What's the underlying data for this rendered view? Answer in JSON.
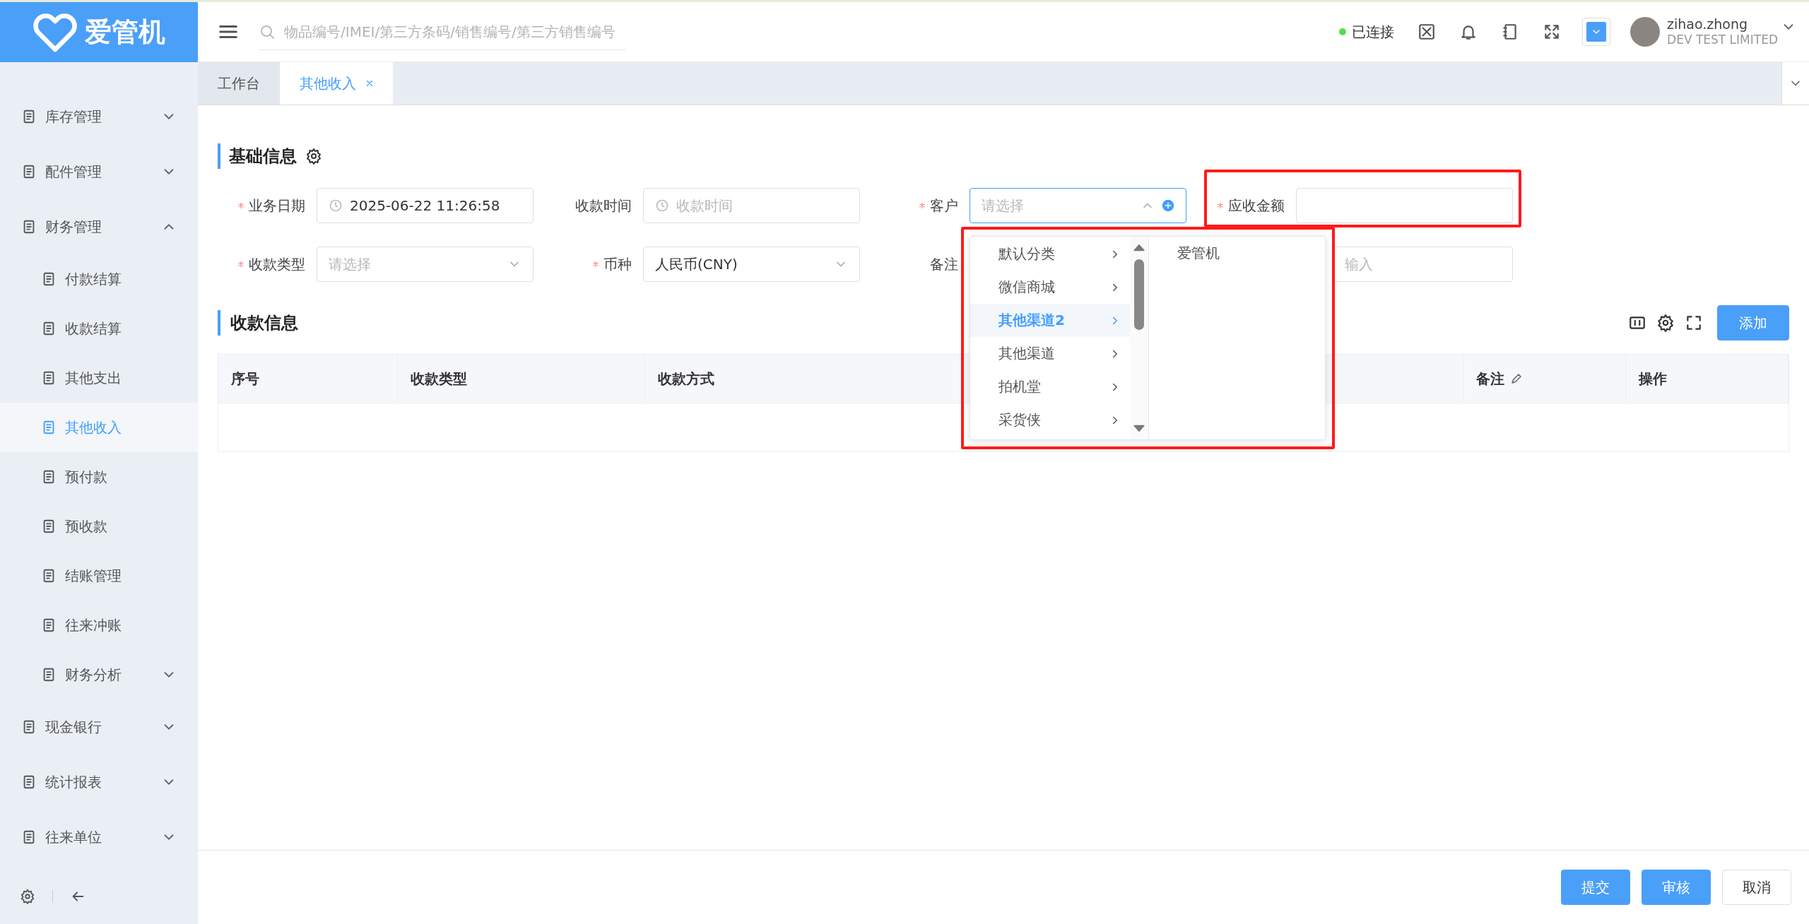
{
  "app": {
    "logo_text": "爱管机"
  },
  "header": {
    "search": {
      "placeholder": "物品编号/IMEI/第三方条码/销售编号/第三方销售编号"
    },
    "status": {
      "label": "已连接",
      "connected": true
    },
    "user": {
      "name": "zihao.zhong",
      "company": "DEV TEST LIMITED"
    }
  },
  "sidebar": {
    "items": [
      {
        "label": "库存管理",
        "kind": "group",
        "expanded": false
      },
      {
        "label": "配件管理",
        "kind": "group",
        "expanded": false
      },
      {
        "label": "财务管理",
        "kind": "group",
        "expanded": true,
        "children": [
          {
            "label": "付款结算",
            "kind": "link",
            "selected": false
          },
          {
            "label": "收款结算",
            "kind": "link",
            "selected": false
          },
          {
            "label": "其他支出",
            "kind": "link",
            "selected": false
          },
          {
            "label": "其他收入",
            "kind": "link",
            "selected": true
          },
          {
            "label": "预付款",
            "kind": "link",
            "selected": false
          },
          {
            "label": "预收款",
            "kind": "link",
            "selected": false
          },
          {
            "label": "结账管理",
            "kind": "link",
            "selected": false
          },
          {
            "label": "往来冲账",
            "kind": "link",
            "selected": false
          },
          {
            "label": "财务分析",
            "kind": "group",
            "expanded": false
          }
        ]
      },
      {
        "label": "现金银行",
        "kind": "group",
        "expanded": false
      },
      {
        "label": "统计报表",
        "kind": "group",
        "expanded": false
      },
      {
        "label": "往来单位",
        "kind": "group",
        "expanded": false
      }
    ]
  },
  "tabs": [
    {
      "label": "工作台",
      "selected": false,
      "closable": false
    },
    {
      "label": "其他收入",
      "selected": true,
      "closable": true
    }
  ],
  "basic_info": {
    "title": "基础信息",
    "fields": [
      {
        "label": "业务日期",
        "required": true,
        "kind": "date",
        "value": "2025-06-22 11:26:58",
        "focused": false
      },
      {
        "label": "收款时间",
        "required": false,
        "kind": "date",
        "placeholder": "收款时间",
        "focused": false
      },
      {
        "label": "客户",
        "required": true,
        "kind": "cascader",
        "placeholder": "请选择",
        "focused": true
      },
      {
        "label": "应收金额",
        "required": true,
        "kind": "text",
        "focused": false
      },
      {
        "label": "收款类型",
        "required": true,
        "kind": "select",
        "placeholder": "请选择",
        "focused": false
      },
      {
        "label": "币种",
        "required": true,
        "kind": "select",
        "value": "人民币(CNY)",
        "focused": false
      },
      {
        "label": "备注",
        "required": false,
        "kind": "textarea",
        "placeholder": "输入",
        "focused": false
      }
    ]
  },
  "dropdown": {
    "options": [
      {
        "label": "默认分类",
        "selected": false
      },
      {
        "label": "微信商城",
        "selected": false
      },
      {
        "label": "其他渠道2",
        "selected": true
      },
      {
        "label": "其他渠道",
        "selected": false
      },
      {
        "label": "拍机堂",
        "selected": false
      },
      {
        "label": "采货侠",
        "selected": false
      }
    ],
    "sub_options": [
      {
        "label": "爱管机"
      }
    ]
  },
  "payment_info": {
    "title": "收款信息",
    "add_button": "添加",
    "table": {
      "columns": [
        {
          "label": "序号",
          "editable": false
        },
        {
          "label": "收款类型",
          "editable": false
        },
        {
          "label": "收款方式",
          "editable": false
        },
        {
          "label": "备注",
          "editable": true
        },
        {
          "label": "操作",
          "editable": false
        }
      ]
    }
  },
  "footer": {
    "buttons": [
      {
        "label": "提交",
        "kind": "primary"
      },
      {
        "label": "审核",
        "kind": "primary"
      },
      {
        "label": "取消",
        "kind": "default"
      }
    ]
  }
}
